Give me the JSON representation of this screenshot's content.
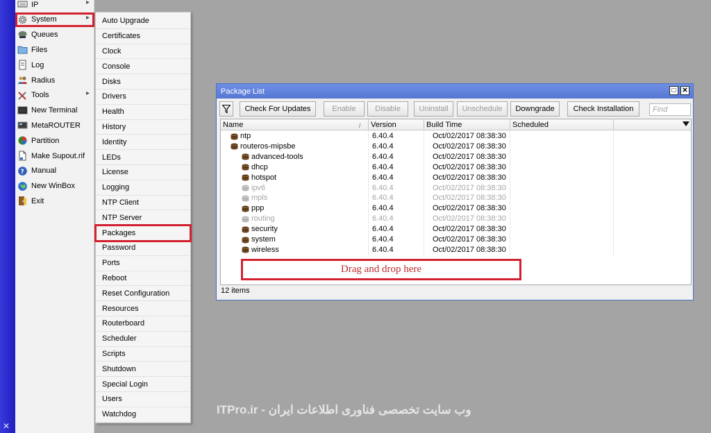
{
  "main_menu": {
    "items": [
      {
        "label": "IP",
        "icon": "ip-icon",
        "submenu": true
      },
      {
        "label": "System",
        "icon": "gear-icon",
        "submenu": true
      },
      {
        "label": "Queues",
        "icon": "queues-icon"
      },
      {
        "label": "Files",
        "icon": "folder-icon"
      },
      {
        "label": "Log",
        "icon": "log-icon"
      },
      {
        "label": "Radius",
        "icon": "radius-users-icon"
      },
      {
        "label": "Tools",
        "icon": "tools-icon",
        "submenu": true
      },
      {
        "label": "New Terminal",
        "icon": "terminal-icon"
      },
      {
        "label": "MetaROUTER",
        "icon": "metarouter-icon"
      },
      {
        "label": "Partition",
        "icon": "partition-icon"
      },
      {
        "label": "Make Supout.rif",
        "icon": "supout-file-icon"
      },
      {
        "label": "Manual",
        "icon": "help-icon"
      },
      {
        "label": "New WinBox",
        "icon": "globe-icon"
      },
      {
        "label": "Exit",
        "icon": "exit-icon"
      }
    ],
    "close_glyph": "✕"
  },
  "system_submenu": {
    "items": [
      "Auto Upgrade",
      "Certificates",
      "Clock",
      "Console",
      "Disks",
      "Drivers",
      "Health",
      "History",
      "Identity",
      "LEDs",
      "License",
      "Logging",
      "NTP Client",
      "NTP Server",
      "Packages",
      "Password",
      "Ports",
      "Reboot",
      "Reset Configuration",
      "Resources",
      "Routerboard",
      "Scheduler",
      "Scripts",
      "Shutdown",
      "Special Login",
      "Users",
      "Watchdog"
    ],
    "highlighted": "Packages"
  },
  "package_window": {
    "title": "Package List",
    "max_glyph": "□",
    "close_glyph": "✕",
    "toolbar": {
      "check_updates": "Check For Updates",
      "enable": "Enable",
      "disable": "Disable",
      "uninstall": "Uninstall",
      "unschedule": "Unschedule",
      "downgrade": "Downgrade",
      "check_installation": "Check Installation",
      "find_placeholder": "Find"
    },
    "columns": {
      "name": "Name",
      "version": "Version",
      "build_time": "Build Time",
      "scheduled": "Scheduled",
      "sort_glyph": "/"
    },
    "rows": [
      {
        "name": "ntp",
        "version": "6.40.4",
        "build_time": "Oct/02/2017 08:38:30",
        "scheduled": "",
        "level": 0,
        "enabled": true
      },
      {
        "name": "routeros-mipsbe",
        "version": "6.40.4",
        "build_time": "Oct/02/2017 08:38:30",
        "scheduled": "",
        "level": 0,
        "enabled": true
      },
      {
        "name": "advanced-tools",
        "version": "6.40.4",
        "build_time": "Oct/02/2017 08:38:30",
        "scheduled": "",
        "level": 1,
        "enabled": true
      },
      {
        "name": "dhcp",
        "version": "6.40.4",
        "build_time": "Oct/02/2017 08:38:30",
        "scheduled": "",
        "level": 1,
        "enabled": true
      },
      {
        "name": "hotspot",
        "version": "6.40.4",
        "build_time": "Oct/02/2017 08:38:30",
        "scheduled": "",
        "level": 1,
        "enabled": true
      },
      {
        "name": "ipv6",
        "version": "6.40.4",
        "build_time": "Oct/02/2017 08:38:30",
        "scheduled": "",
        "level": 1,
        "enabled": false
      },
      {
        "name": "mpls",
        "version": "6.40.4",
        "build_time": "Oct/02/2017 08:38:30",
        "scheduled": "",
        "level": 1,
        "enabled": false
      },
      {
        "name": "ppp",
        "version": "6.40.4",
        "build_time": "Oct/02/2017 08:38:30",
        "scheduled": "",
        "level": 1,
        "enabled": true
      },
      {
        "name": "routing",
        "version": "6.40.4",
        "build_time": "Oct/02/2017 08:38:30",
        "scheduled": "",
        "level": 1,
        "enabled": false
      },
      {
        "name": "security",
        "version": "6.40.4",
        "build_time": "Oct/02/2017 08:38:30",
        "scheduled": "",
        "level": 1,
        "enabled": true
      },
      {
        "name": "system",
        "version": "6.40.4",
        "build_time": "Oct/02/2017 08:38:30",
        "scheduled": "",
        "level": 1,
        "enabled": true
      },
      {
        "name": "wireless",
        "version": "6.40.4",
        "build_time": "Oct/02/2017 08:38:30",
        "scheduled": "",
        "level": 1,
        "enabled": true
      }
    ],
    "dropzone_label": "Drag and drop here",
    "status": "12 items"
  },
  "watermark": "ITPro.ir - وب سایت تخصصی فناوری اطلاعات ایران",
  "colors": {
    "highlight_red": "#d32030",
    "title_blue": "#5b7bd5",
    "strip_blue": "#2a2ad0"
  }
}
